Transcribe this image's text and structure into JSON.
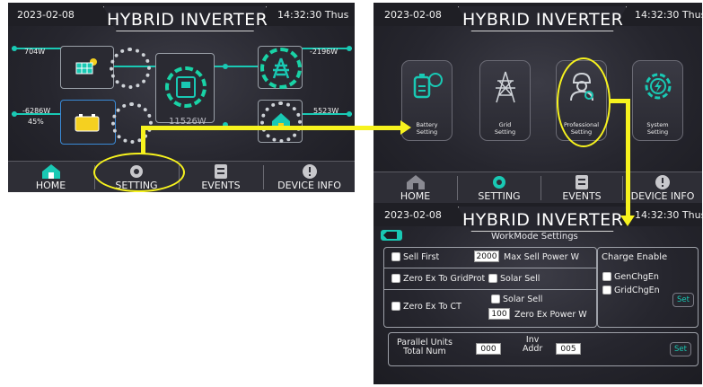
{
  "header": {
    "date": "2023-02-08",
    "title": "HYBRID INVERTER",
    "time": "14:32:30 Thus",
    "time_short": "14:32:30 Thus"
  },
  "home": {
    "solar_power": "704W",
    "battery_power": "-6286W",
    "battery_soc": "45%",
    "grid_power": "-2196W",
    "load_power": "5523W",
    "inverter_power": "11526W"
  },
  "nav": {
    "home": "HOME",
    "setting": "SETTING",
    "events": "EVENTS",
    "device_info": "DEVICE INFO"
  },
  "settings_menu": {
    "battery": "Battery\nSetting",
    "grid": "Grid\nSetting",
    "professional": "Professional\nSetting",
    "system": "System\nSetting"
  },
  "workmode": {
    "title": "WorkMode Settings",
    "sell_first": "Sell First",
    "max_sell_value": "2000",
    "max_sell_label": "Max Sell Power W",
    "zero_ex_grid": "Zero Ex To GridProt",
    "solar_sell_1": "Solar Sell",
    "zero_ex_ct": "Zero Ex To CT",
    "solar_sell_2": "Solar Sell",
    "zero_ex_value": "100",
    "zero_ex_label": "Zero Ex Power W",
    "charge_enable": "Charge Enable",
    "gen_chg": "GenChgEn",
    "grid_chg": "GridChgEn",
    "set_1": "Set",
    "parallel_label": "Parallel Units\nTotal Num",
    "parallel_value": "000",
    "inv_addr_label": "Inv\nAddr",
    "inv_addr_value": "005",
    "set_2": "Set"
  },
  "colors": {
    "accent": "#19c9b4",
    "highlight": "#f7f31e",
    "background": "#26262e"
  }
}
